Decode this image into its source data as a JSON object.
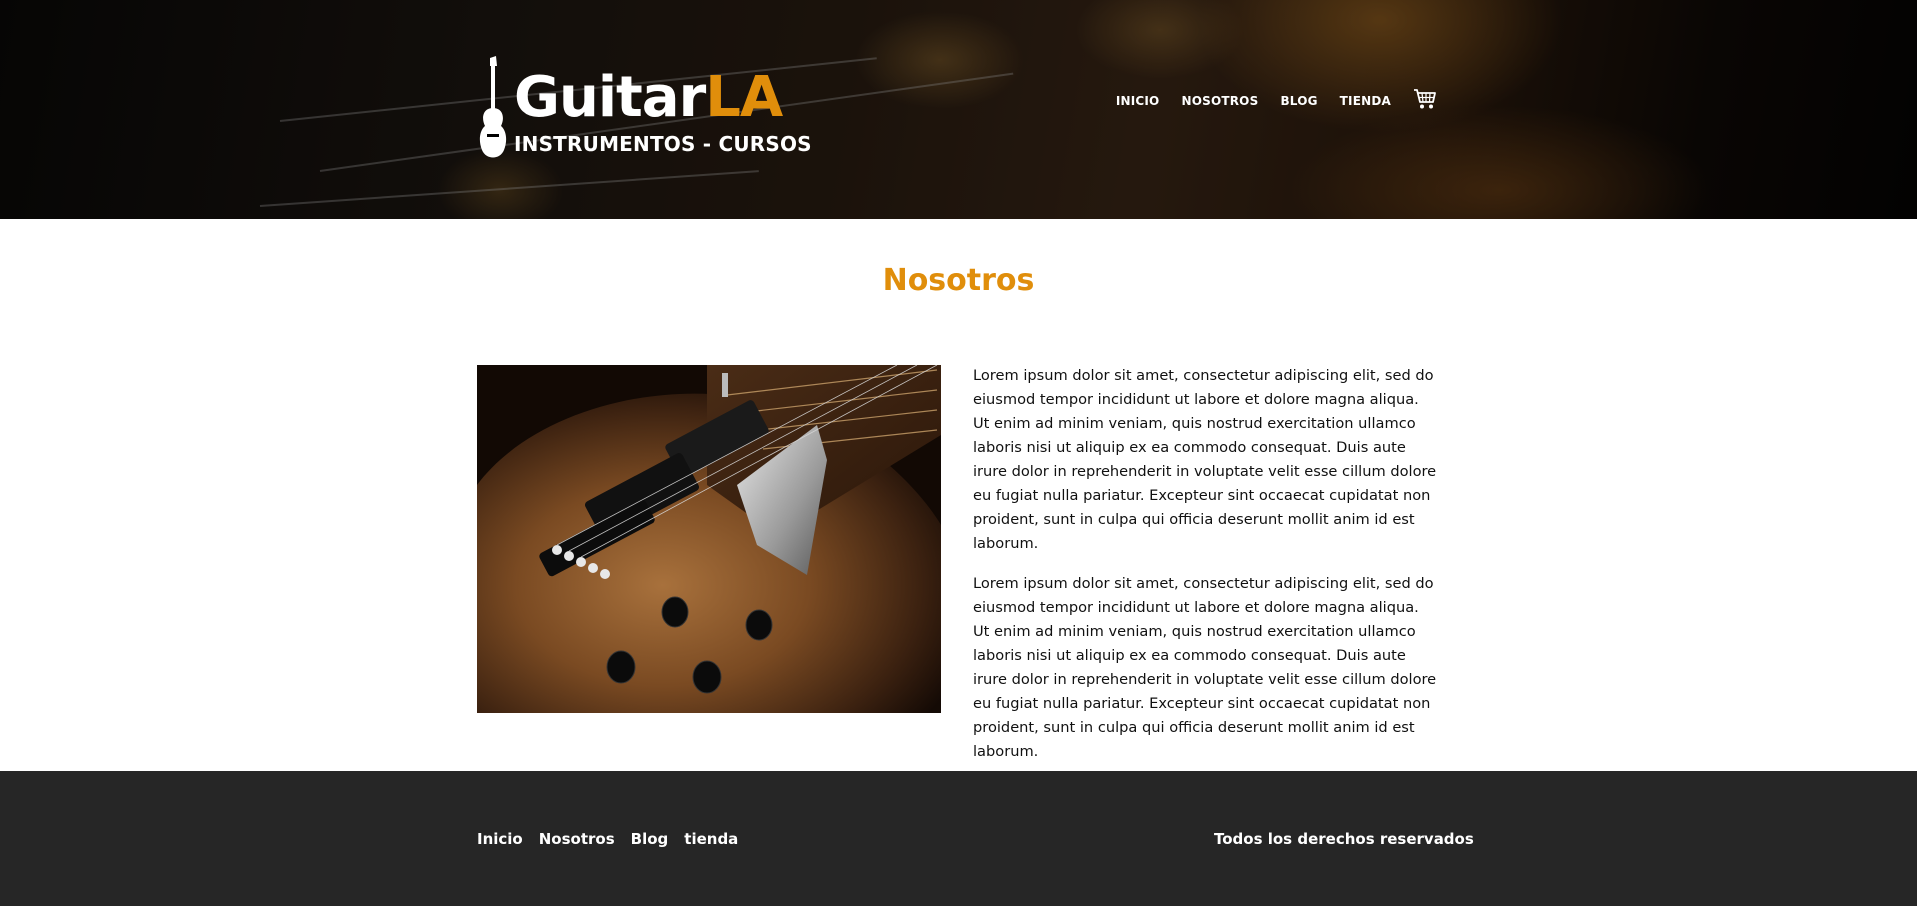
{
  "header": {
    "brand": {
      "main": "Guitar",
      "accent": "LA",
      "tagline": "INSTRUMENTOS - CURSOS"
    },
    "nav": [
      {
        "label": "INICIO"
      },
      {
        "label": "NOSOTROS"
      },
      {
        "label": "BLOG"
      },
      {
        "label": "TIENDA"
      }
    ],
    "cart_icon": "shopping-cart-icon"
  },
  "main": {
    "title": "Nosotros",
    "image_alt": "guitar-image",
    "paragraphs": [
      "Lorem ipsum dolor sit amet, consectetur adipiscing elit, sed do eiusmod tempor incididunt ut labore et dolore magna aliqua. Ut enim ad minim veniam, quis nostrud exercitation ullamco laboris nisi ut aliquip ex ea commodo consequat. Duis aute irure dolor in reprehenderit in voluptate velit esse cillum dolore eu fugiat nulla pariatur. Excepteur sint occaecat cupidatat non proident, sunt in culpa qui officia deserunt mollit anim id est laborum.",
      "Lorem ipsum dolor sit amet, consectetur adipiscing elit, sed do eiusmod tempor incididunt ut labore et dolore magna aliqua. Ut enim ad minim veniam, quis nostrud exercitation ullamco laboris nisi ut aliquip ex ea commodo consequat. Duis aute irure dolor in reprehenderit in voluptate velit esse cillum dolore eu fugiat nulla pariatur. Excepteur sint occaecat cupidatat non proident, sunt in culpa qui officia deserunt mollit anim id est laborum."
    ]
  },
  "footer": {
    "nav": [
      {
        "label": "Inicio"
      },
      {
        "label": "Nosotros"
      },
      {
        "label": "Blog"
      },
      {
        "label": "tienda"
      }
    ],
    "copyright": "Todos los derechos reservados"
  },
  "colors": {
    "accent": "#e08e0b",
    "footer_bg": "#262626",
    "text": "#111111"
  }
}
